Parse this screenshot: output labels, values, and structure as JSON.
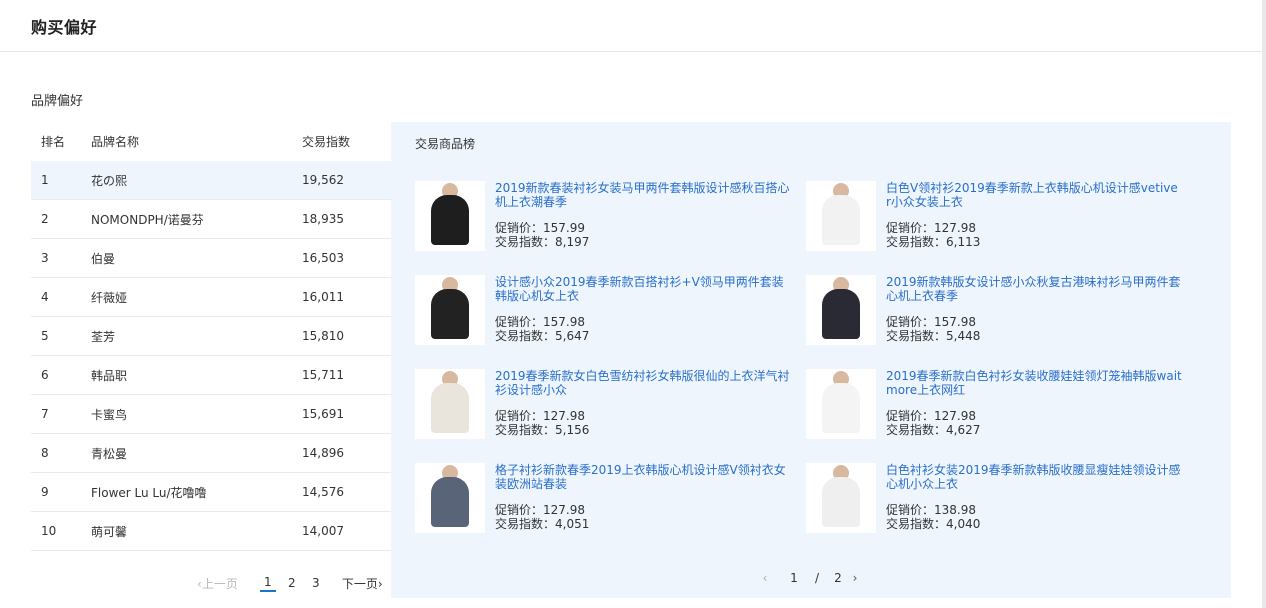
{
  "header": {
    "title": "购买偏好"
  },
  "brand_section": {
    "title": "品牌偏好",
    "columns": {
      "rank": "排名",
      "name": "品牌名称",
      "index": "交易指数"
    },
    "rows": [
      {
        "rank": "1",
        "name": "花の熙",
        "index": "19,562"
      },
      {
        "rank": "2",
        "name": "NOMONDPH/诺曼芬",
        "index": "18,935"
      },
      {
        "rank": "3",
        "name": "伯曼",
        "index": "16,503"
      },
      {
        "rank": "4",
        "name": "纤薇娅",
        "index": "16,011"
      },
      {
        "rank": "5",
        "name": "荃芳",
        "index": "15,810"
      },
      {
        "rank": "6",
        "name": "韩品职",
        "index": "15,711"
      },
      {
        "rank": "7",
        "name": "卡蜜鸟",
        "index": "15,691"
      },
      {
        "rank": "8",
        "name": "青松曼",
        "index": "14,896"
      },
      {
        "rank": "9",
        "name": "Flower Lu Lu/花噜噜",
        "index": "14,576"
      },
      {
        "rank": "10",
        "name": "萌可馨",
        "index": "14,007"
      }
    ],
    "pager": {
      "prev": "上一页",
      "pages": [
        "1",
        "2",
        "3"
      ],
      "current": "1",
      "next": "下一页"
    }
  },
  "product_section": {
    "title": "交易商品榜",
    "price_label": "促销价：",
    "index_label": "交易指数：",
    "products": [
      {
        "title": "2019新款春装衬衫女装马甲两件套韩版设计感秋百搭心机上衣潮春季",
        "price": "157.99",
        "index": "8,197",
        "color": "#1e1e1e"
      },
      {
        "title": "白色V领衬衫2019春季新款上衣韩版心机设计感vetiver小众女装上衣",
        "price": "127.98",
        "index": "6,113",
        "color": "#f2f2f2"
      },
      {
        "title": "设计感小众2019春季新款百搭衬衫+V领马甲两件套装韩版心机女上衣",
        "price": "157.98",
        "index": "5,647",
        "color": "#222222"
      },
      {
        "title": "2019新款韩版女设计感小众秋复古港味衬衫马甲两件套心机上衣春季",
        "price": "157.98",
        "index": "5,448",
        "color": "#2a2a35"
      },
      {
        "title": "2019春季新款女白色雪纺衬衫女韩版很仙的上衣洋气衬衫设计感小众",
        "price": "127.98",
        "index": "5,156",
        "color": "#e9e4dc"
      },
      {
        "title": "2019春季新款白色衬衫女装收腰娃娃领灯笼袖韩版waitmore上衣网红",
        "price": "127.98",
        "index": "4,627",
        "color": "#f4f4f4"
      },
      {
        "title": "格子衬衫新款春季2019上衣韩版心机设计感V领衬衣女装欧洲站春装",
        "price": "127.98",
        "index": "4,051",
        "color": "#5a6478"
      },
      {
        "title": "白色衬衫女装2019春季新款韩版收腰显瘦娃娃领设计感心机小众上衣",
        "price": "138.98",
        "index": "4,040",
        "color": "#efefef"
      }
    ],
    "pager": {
      "current": "1",
      "sep": "/",
      "total": "2"
    }
  }
}
